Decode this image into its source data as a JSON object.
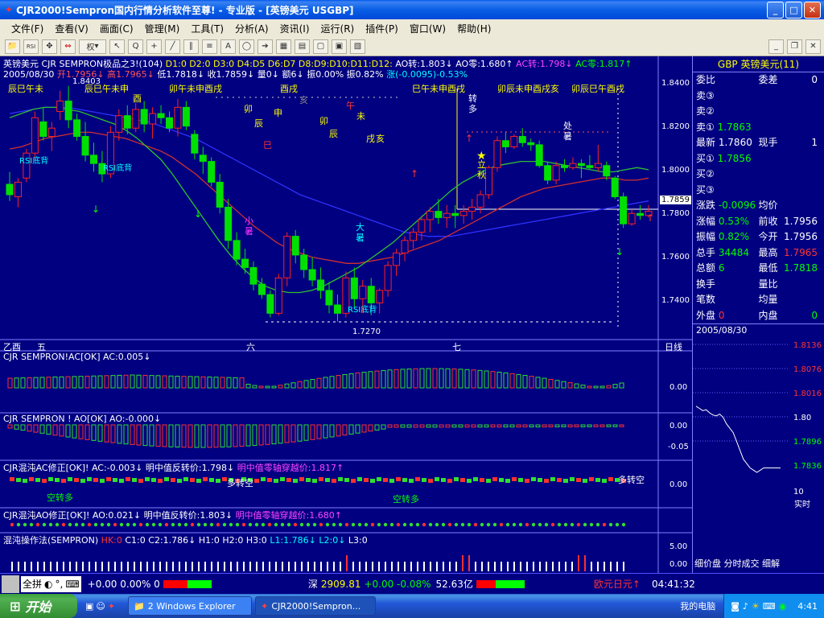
{
  "window": {
    "title": "CJR2000!Sempron国内行情分析软件至尊! - 专业版 - [英镑美元 USGBP]"
  },
  "menu": [
    "文件(F)",
    "查看(V)",
    "画面(C)",
    "管理(M)",
    "工具(T)",
    "分析(A)",
    "资讯(I)",
    "运行(R)",
    "插件(P)",
    "窗口(W)",
    "帮助(H)"
  ],
  "toolbar": {
    "rights_label": "权"
  },
  "main_chart": {
    "header1": {
      "prefix": "英镑美元 CJR SEMPRON极品之3!(104)",
      "d_labels": "D1:0 D2:0 D3:0 D4:D5 D6:D7 D8:D9:D10:D11:D12:",
      "ao_zhuan": "AO转:1.803↓",
      "ao_ling": "AO零:1.680↑",
      "ac_zhuan": "AC转:1.798↓",
      "ac_ling": "AC零:1.817↑"
    },
    "header2": {
      "date": "2005/08/30",
      "open": "开1.7956↓",
      "high": "高1.7965↓",
      "low": "低1.7818↓",
      "close": "收1.7859↓",
      "vol": "量0↓",
      "amt": "额6↓",
      "change": "振0.00%",
      "amp": "振0.82%",
      "diff": "涨(-0.0095)-0.53%"
    },
    "price_axis": [
      "1.8400",
      "1.8200",
      "1.8000",
      "1.7800",
      "1.7600",
      "1.7400"
    ],
    "price_tag": "1.7859",
    "high_mark": "1.8403",
    "low_mark": "1.7270",
    "annotations": {
      "rsi1": "RSI底背",
      "rsi2": "RSI底背",
      "rsi3": "RSI底背",
      "xiaoshu": "小暑",
      "dashu": "大暑",
      "liqiu": "立秋",
      "chushu": "处暑",
      "zhuanduo": "转多"
    },
    "branch_labels": [
      "辰巳午未",
      "辰巳午未申",
      "卯午未申酉戌",
      "酉戌",
      "巳午未申酉戌",
      "卯辰未申酉戌亥",
      "卯辰巳午酉戌"
    ],
    "scattered_branches": [
      "亥",
      "酉",
      "卯",
      "申",
      "辰",
      "巳",
      "卯",
      "辰",
      "午",
      "未",
      "亥",
      "戌"
    ],
    "date_axis": [
      "乙酉",
      "五",
      "六",
      "七"
    ],
    "period_label": "日线"
  },
  "ac_panel": {
    "label": "CJR SEMPRON!AC[OK]",
    "value": "AC:0.005↓",
    "axis": [
      "0.00"
    ]
  },
  "ao_panel": {
    "label": "CJR SEMPRON ! AO[OK]",
    "value": "AO:-0.000↓",
    "axis": [
      "0.00",
      "-0.05"
    ]
  },
  "chaos_ac_panel": {
    "label": "CJR混沌AC修正[OK]!",
    "value": "AC:-0.003↓",
    "pivot": "明中值反转价:1.798↓",
    "zero": "明中值零轴穿越价:1.817↑",
    "text_kong": "空转多",
    "text_duo": "多转空",
    "text_kong2": "空转多",
    "text_duo2": "多转空",
    "axis": [
      "0.00"
    ]
  },
  "chaos_ao_panel": {
    "label": "CJR混沌AO修正[OK]!",
    "value": "AO:0.021↓",
    "pivot": "明中值反转价:1.803↓",
    "zero": "明中值零轴穿越价:1.680↑"
  },
  "op_panel": {
    "label": "混沌操作法(SEMPRON)",
    "hk": "HK:0",
    "c1": "C1:0",
    "c2": "C2:1.786↓",
    "h1": "H1:0",
    "h2": "H2:0",
    "h3": "H3:0",
    "l1": "L1:1.786↓",
    "l2": "L2:0↓",
    "l3": "L3:0",
    "axis": [
      "5.00",
      "0.00"
    ]
  },
  "quote": {
    "title": "GBP 英镑美元(11)",
    "rows": [
      [
        "委比",
        "",
        "委差",
        "0"
      ],
      [
        "卖③",
        "",
        "",
        ""
      ],
      [
        "卖②",
        "",
        "",
        ""
      ],
      [
        "卖①",
        "1.7863",
        "",
        ""
      ],
      [
        "最新",
        "1.7860",
        "现手",
        "1"
      ],
      [
        "买①",
        "1.7856",
        "",
        ""
      ],
      [
        "买②",
        "",
        "",
        ""
      ],
      [
        "买③",
        "",
        "",
        ""
      ],
      [
        "涨跌",
        "-0.0096",
        "均价",
        ""
      ],
      [
        "涨幅",
        "0.53%",
        "前收",
        "1.7956"
      ],
      [
        "振幅",
        "0.82%",
        "今开",
        "1.7956"
      ],
      [
        "总手",
        "34484",
        "最高",
        "1.7965"
      ],
      [
        "总额",
        "6",
        "最低",
        "1.7818"
      ],
      [
        "换手",
        "",
        "量比",
        ""
      ],
      [
        "笔数",
        "",
        "均量",
        ""
      ],
      [
        "外盘",
        "0",
        "内盘",
        "0"
      ]
    ],
    "date": "2005/08/30",
    "mini_axis": [
      "1.8136",
      "1.8076",
      "1.8016",
      "1.80",
      "1.7896",
      "1.7836",
      "10"
    ],
    "realtime": "实时",
    "tabs": "细价盘 分时成交 细解"
  },
  "status": {
    "quanpin": "全拼",
    "index1": "+0.00 0.00% 0",
    "deep_label": "深",
    "deep_value": "2909.81",
    "deep_change": "+0.00 -0.08%",
    "deep_amount": "52.63亿",
    "ticker": "欧元日元↑",
    "time": "04:41:32"
  },
  "taskbar": {
    "start": "开始",
    "task1": "2 Windows Explorer",
    "task2": "CJR2000!Sempron...",
    "mycomputer": "我的电脑",
    "clock": "4:41"
  },
  "colors": {
    "bg": "#000080",
    "up": "#ff2020",
    "down": "#00e000",
    "ma_slow": "#3030ff",
    "ma_mid": "#e03030",
    "ma_fast": "#30c030"
  },
  "chart_data": {
    "type": "candlestick",
    "price_range": [
      1.723,
      1.846
    ],
    "candles": [
      [
        1.793,
        1.799,
        1.785,
        1.788
      ],
      [
        1.787,
        1.796,
        1.782,
        1.794
      ],
      [
        1.796,
        1.81,
        1.794,
        1.808
      ],
      [
        1.808,
        1.828,
        1.804,
        1.825
      ],
      [
        1.823,
        1.83,
        1.814,
        1.816
      ],
      [
        1.816,
        1.823,
        1.809,
        1.82
      ],
      [
        1.828,
        1.838,
        1.824,
        1.833
      ],
      [
        1.833,
        1.8403,
        1.82,
        1.824
      ],
      [
        1.824,
        1.827,
        1.814,
        1.816
      ],
      [
        1.816,
        1.823,
        1.804,
        1.807
      ],
      [
        1.807,
        1.813,
        1.799,
        1.803
      ],
      [
        1.803,
        1.809,
        1.794,
        1.798
      ],
      [
        1.798,
        1.821,
        1.796,
        1.818
      ],
      [
        1.818,
        1.829,
        1.814,
        1.826
      ],
      [
        1.826,
        1.831,
        1.817,
        1.82
      ],
      [
        1.82,
        1.832,
        1.818,
        1.829
      ],
      [
        1.829,
        1.833,
        1.818,
        1.822
      ],
      [
        1.822,
        1.83,
        1.815,
        1.827
      ],
      [
        1.827,
        1.831,
        1.822,
        1.825
      ],
      [
        1.825,
        1.828,
        1.818,
        1.82
      ],
      [
        1.82,
        1.834,
        1.816,
        1.83
      ],
      [
        1.83,
        1.833,
        1.819,
        1.821
      ],
      [
        1.817,
        1.819,
        1.805,
        1.808
      ],
      [
        1.807,
        1.811,
        1.798,
        1.804
      ],
      [
        1.804,
        1.806,
        1.792,
        1.794
      ],
      [
        1.794,
        1.798,
        1.779,
        1.782
      ],
      [
        1.782,
        1.786,
        1.762,
        1.766
      ],
      [
        1.766,
        1.77,
        1.754,
        1.757
      ],
      [
        1.757,
        1.762,
        1.75,
        1.753
      ],
      [
        1.753,
        1.756,
        1.742,
        1.745
      ],
      [
        1.745,
        1.748,
        1.738,
        1.74
      ],
      [
        1.74,
        1.742,
        1.729,
        1.731
      ],
      [
        1.731,
        1.75,
        1.73,
        1.748
      ],
      [
        1.748,
        1.77,
        1.744,
        1.768
      ],
      [
        1.768,
        1.771,
        1.755,
        1.759
      ],
      [
        1.759,
        1.762,
        1.748,
        1.752
      ],
      [
        1.752,
        1.758,
        1.744,
        1.747
      ],
      [
        1.747,
        1.753,
        1.738,
        1.742
      ],
      [
        1.742,
        1.746,
        1.731,
        1.735
      ],
      [
        1.735,
        1.74,
        1.727,
        1.731
      ],
      [
        1.731,
        1.751,
        1.729,
        1.748
      ],
      [
        1.748,
        1.753,
        1.734,
        1.738
      ],
      [
        1.738,
        1.747,
        1.731,
        1.744
      ],
      [
        1.744,
        1.748,
        1.73,
        1.736
      ],
      [
        1.736,
        1.743,
        1.731,
        1.742
      ],
      [
        1.742,
        1.756,
        1.739,
        1.754
      ],
      [
        1.754,
        1.762,
        1.749,
        1.76
      ],
      [
        1.76,
        1.768,
        1.756,
        1.766
      ],
      [
        1.766,
        1.772,
        1.762,
        1.77
      ],
      [
        1.77,
        1.778,
        1.766,
        1.776
      ],
      [
        1.776,
        1.782,
        1.77,
        1.78
      ],
      [
        1.78,
        1.786,
        1.774,
        1.777
      ],
      [
        1.777,
        1.783,
        1.772,
        1.779
      ],
      [
        1.779,
        1.783,
        1.772,
        1.778
      ],
      [
        1.778,
        1.783,
        1.774,
        1.78
      ],
      [
        1.78,
        1.786,
        1.776,
        1.782
      ],
      [
        1.782,
        1.79,
        1.779,
        1.788
      ],
      [
        1.788,
        1.802,
        1.786,
        1.801
      ],
      [
        1.801,
        1.816,
        1.799,
        1.814
      ],
      [
        1.814,
        1.818,
        1.808,
        1.811
      ],
      [
        1.811,
        1.817,
        1.81,
        1.816
      ],
      [
        1.816,
        1.82,
        1.811,
        1.813
      ],
      [
        1.813,
        1.815,
        1.809,
        1.812
      ],
      [
        1.812,
        1.814,
        1.801,
        1.802
      ],
      [
        1.802,
        1.804,
        1.793,
        1.795
      ],
      [
        1.795,
        1.804,
        1.793,
        1.802
      ],
      [
        1.802,
        1.805,
        1.799,
        1.801
      ],
      [
        1.801,
        1.806,
        1.8,
        1.803
      ],
      [
        1.803,
        1.805,
        1.796,
        1.802
      ],
      [
        1.802,
        1.807,
        1.8,
        1.801
      ],
      [
        1.801,
        1.812,
        1.799,
        1.803
      ],
      [
        1.802,
        1.804,
        1.795,
        1.797
      ],
      [
        1.796,
        1.797,
        1.786,
        1.787
      ],
      [
        1.787,
        1.789,
        1.772,
        1.774
      ],
      [
        1.774,
        1.781,
        1.773,
        1.779
      ],
      [
        1.779,
        1.783,
        1.776,
        1.778
      ],
      [
        1.778,
        1.783,
        1.777,
        1.78
      ]
    ],
    "ma_slow": [
      1.827,
      1.828,
      1.829,
      1.83,
      1.83,
      1.83,
      1.829,
      1.828,
      1.827,
      1.826,
      1.825,
      1.824,
      1.823,
      1.821,
      1.819,
      1.817,
      1.815,
      1.812,
      1.809,
      1.806,
      1.803,
      1.8,
      1.797,
      1.794,
      1.791,
      1.788,
      1.786,
      1.784,
      1.782,
      1.78,
      1.778,
      1.776,
      1.774,
      1.772,
      1.77,
      1.769,
      1.768,
      1.768,
      1.768,
      1.769,
      1.77,
      1.771,
      1.772,
      1.773,
      1.774,
      1.775,
      1.776,
      1.777,
      1.778,
      1.779,
      1.78,
      1.781,
      1.782,
      1.783,
      1.784,
      1.785
    ],
    "ma_mid": [
      1.81,
      1.811,
      1.813,
      1.815,
      1.816,
      1.817,
      1.818,
      1.818,
      1.817,
      1.816,
      1.815,
      1.813,
      1.811,
      1.809,
      1.806,
      1.802,
      1.798,
      1.793,
      1.788,
      1.783,
      1.778,
      1.773,
      1.769,
      1.765,
      1.762,
      1.76,
      1.758,
      1.757,
      1.756,
      1.755,
      1.755,
      1.756,
      1.757,
      1.758,
      1.76,
      1.762,
      1.764,
      1.766,
      1.769,
      1.772,
      1.775,
      1.778,
      1.781,
      1.784,
      1.787,
      1.789,
      1.791,
      1.792,
      1.793,
      1.794,
      1.795,
      1.796,
      1.796,
      1.795,
      1.795,
      1.796
    ],
    "ma_fast": [
      1.825,
      1.827,
      1.829,
      1.83,
      1.83,
      1.829,
      1.828,
      1.826,
      1.824,
      1.822,
      1.819,
      1.815,
      1.81,
      1.805,
      1.798,
      1.79,
      1.782,
      1.774,
      1.766,
      1.759,
      1.753,
      1.748,
      1.744,
      1.742,
      1.741,
      1.741,
      1.742,
      1.744,
      1.747,
      1.75,
      1.753,
      1.757,
      1.761,
      1.765,
      1.77,
      1.775,
      1.78,
      1.785,
      1.79,
      1.794,
      1.797,
      1.8,
      1.802,
      1.803,
      1.804,
      1.804,
      1.804,
      1.803,
      1.802,
      1.801,
      1.8,
      1.799,
      1.799,
      1.8,
      1.801,
      1.8
    ],
    "mini_line": [
      1.8,
      1.7995,
      1.799,
      1.7992,
      1.7985,
      1.798,
      1.7978,
      1.7982,
      1.7975,
      1.796,
      1.795,
      1.794,
      1.792,
      1.79,
      1.788,
      1.787,
      1.786,
      1.7855,
      1.785,
      1.7855,
      1.786,
      1.786,
      1.786,
      1.786,
      1.786,
      1.786
    ]
  }
}
